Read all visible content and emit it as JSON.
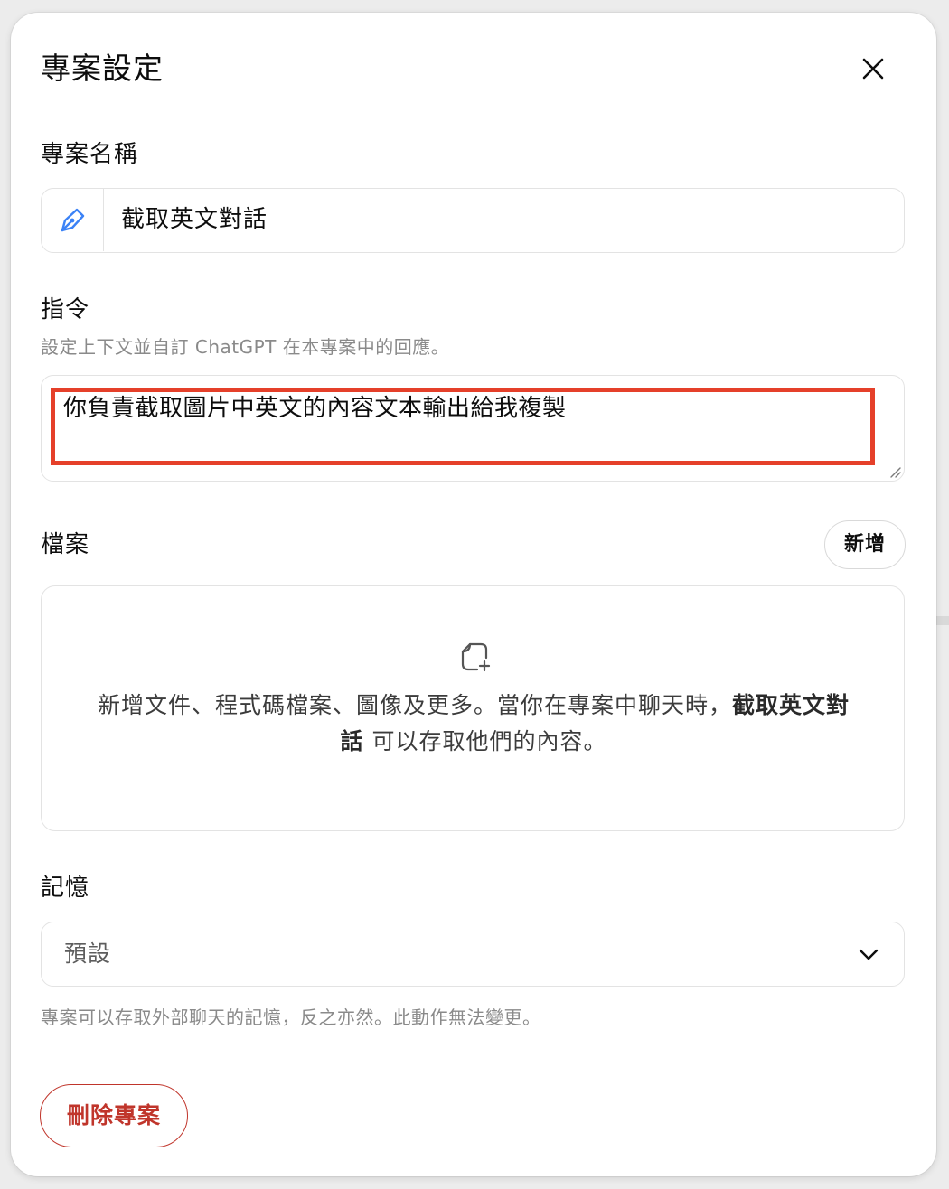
{
  "dialog": {
    "title": "專案設定"
  },
  "project_name": {
    "label": "專案名稱",
    "value": "截取英文對話"
  },
  "instructions": {
    "label": "指令",
    "hint": "設定上下文並自訂 ChatGPT 在本專案中的回應。",
    "value": "你負責截取圖片中英文的內容文本輸出給我複製",
    "highlight_color": "#e5402a"
  },
  "files": {
    "label": "檔案",
    "add_label": "新增",
    "empty_text_before": "新增文件、程式碼檔案、圖像及更多。當你在專案中聊天時，",
    "empty_text_project": "截取英文對話",
    "empty_text_after": " 可以存取他們的內容。"
  },
  "memory": {
    "label": "記憶",
    "selected": "預設",
    "hint": "專案可以存取外部聊天的記憶，反之亦然。此動作無法變更。"
  },
  "delete": {
    "label": "刪除專案",
    "color": "#c0352b"
  },
  "colors": {
    "accent_icon": "#3b82f6"
  }
}
